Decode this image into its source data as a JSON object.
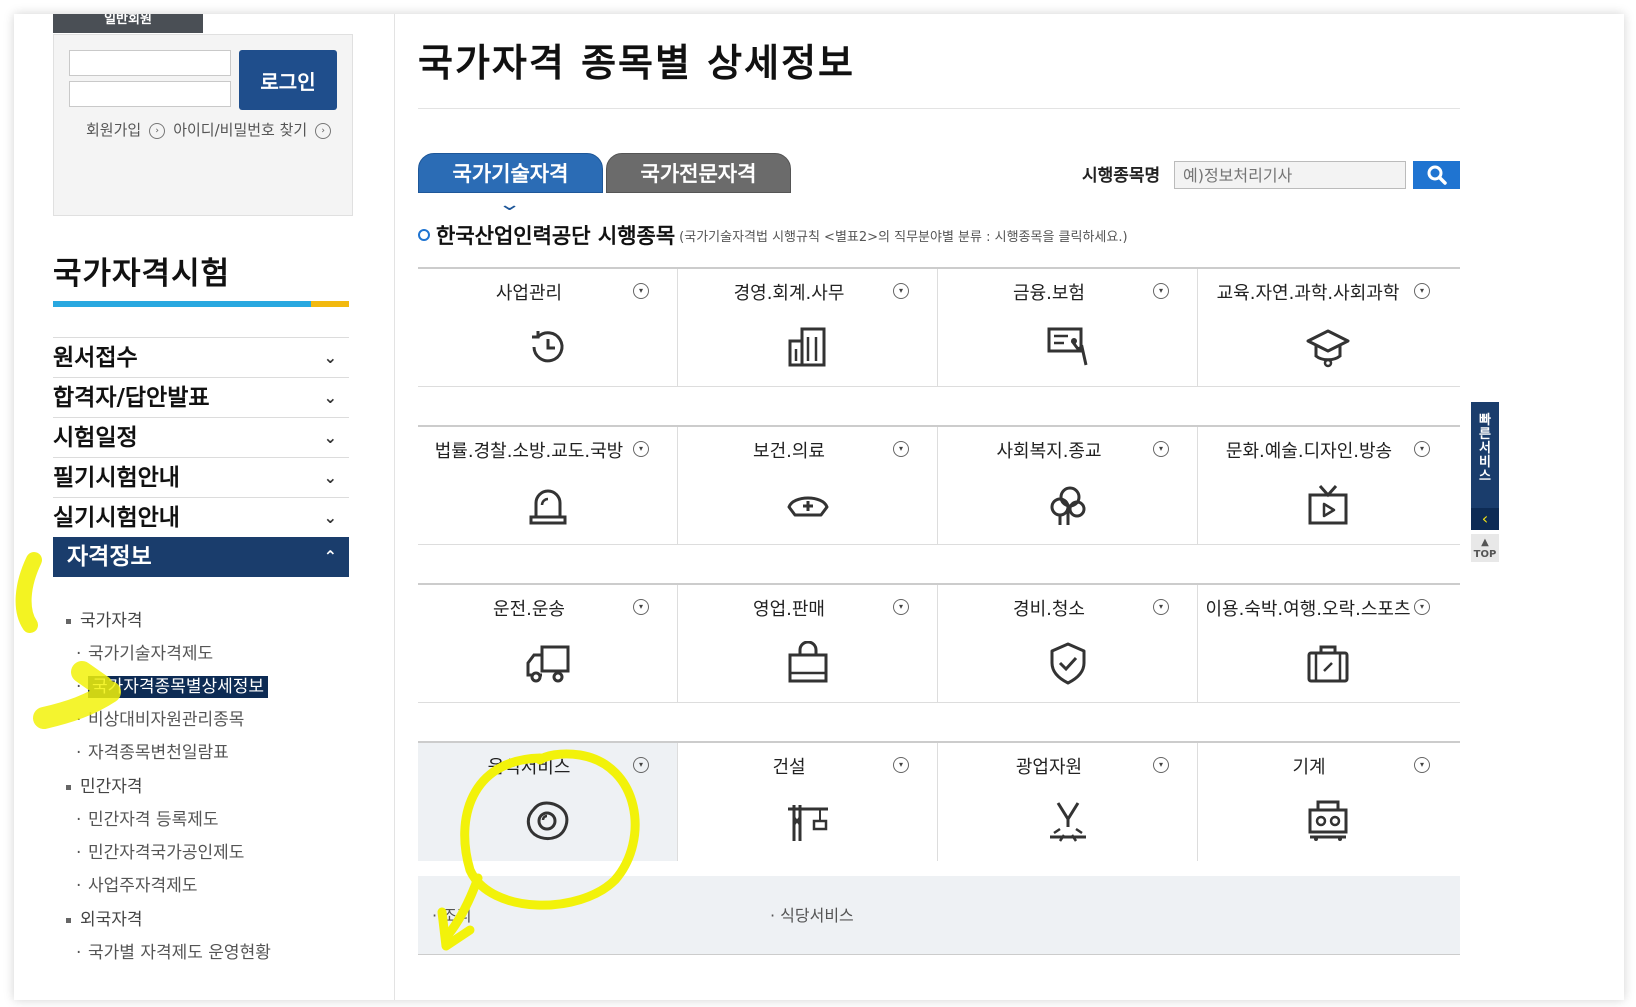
{
  "login": {
    "tab_label": "일반회원",
    "button": "로그인",
    "join": "회원가입",
    "find": "아이디/비밀번호 찾기"
  },
  "sidebar": {
    "title": "국가자격시험",
    "menu": [
      {
        "label": "원서접수"
      },
      {
        "label": "합격자/답안발표"
      },
      {
        "label": "시험일정"
      },
      {
        "label": "필기시험안내"
      },
      {
        "label": "실기시험안내"
      },
      {
        "label": "자격정보"
      }
    ],
    "sub": {
      "national": "국가자격",
      "national_items": [
        "국가기술자격제도",
        "국가자격종목별상세정보",
        "비상대비자원관리종목",
        "자격종목변천일람표"
      ],
      "private": "민간자격",
      "private_items": [
        "민간자격 등록제도",
        "민간자격국가공인제도",
        "사업주자격제도"
      ],
      "foreign": "외국자격",
      "foreign_items": [
        "국가별 자격제도 운영현황"
      ]
    }
  },
  "main": {
    "title": "국가자격 종목별 상세정보",
    "tabs": [
      "국가기술자격",
      "국가전문자격"
    ],
    "search_label": "시행종목명",
    "search_placeholder": "예)정보처리기사",
    "subhead_title": "한국산업인력공단 시행종목",
    "subhead_note": "(국가기술자격법 시행규칙 <별표2>의 직무분야별 분류 : 시행종목을 클릭하세요.)"
  },
  "categories": [
    {
      "label": "사업관리",
      "icon": "clock-icon"
    },
    {
      "label": "경영.회계.사무",
      "icon": "building-icon"
    },
    {
      "label": "금융.보험",
      "icon": "presentation-icon"
    },
    {
      "label": "교육.자연.과학.사회과학",
      "icon": "graduation-cap-icon"
    },
    {
      "label": "법률.경찰.소방.교도.국방",
      "icon": "siren-icon"
    },
    {
      "label": "보건.의료",
      "icon": "nurse-cap-icon"
    },
    {
      "label": "사회복지.종교",
      "icon": "tree-icon"
    },
    {
      "label": "문화.예술.디자인.방송",
      "icon": "tv-icon"
    },
    {
      "label": "운전.운송",
      "icon": "truck-icon"
    },
    {
      "label": "영업.판매",
      "icon": "shopping-bag-icon"
    },
    {
      "label": "경비.청소",
      "icon": "shield-icon"
    },
    {
      "label": "이용.숙박.여행.오락.스포츠",
      "icon": "suitcase-icon"
    },
    {
      "label": "음식서비스",
      "icon": "fried-egg-icon"
    },
    {
      "label": "건설",
      "icon": "crane-icon"
    },
    {
      "label": "광업자원",
      "icon": "mining-icon"
    },
    {
      "label": "기계",
      "icon": "machine-icon"
    }
  ],
  "expanded": {
    "options": [
      "조리",
      "식당서비스"
    ]
  },
  "quick": {
    "label": "빠른서비스",
    "top": "TOP"
  },
  "colors": {
    "accent_blue": "#1f74d1",
    "nav_dark": "#1a3d6c",
    "highlighter": "#f2f20a"
  }
}
